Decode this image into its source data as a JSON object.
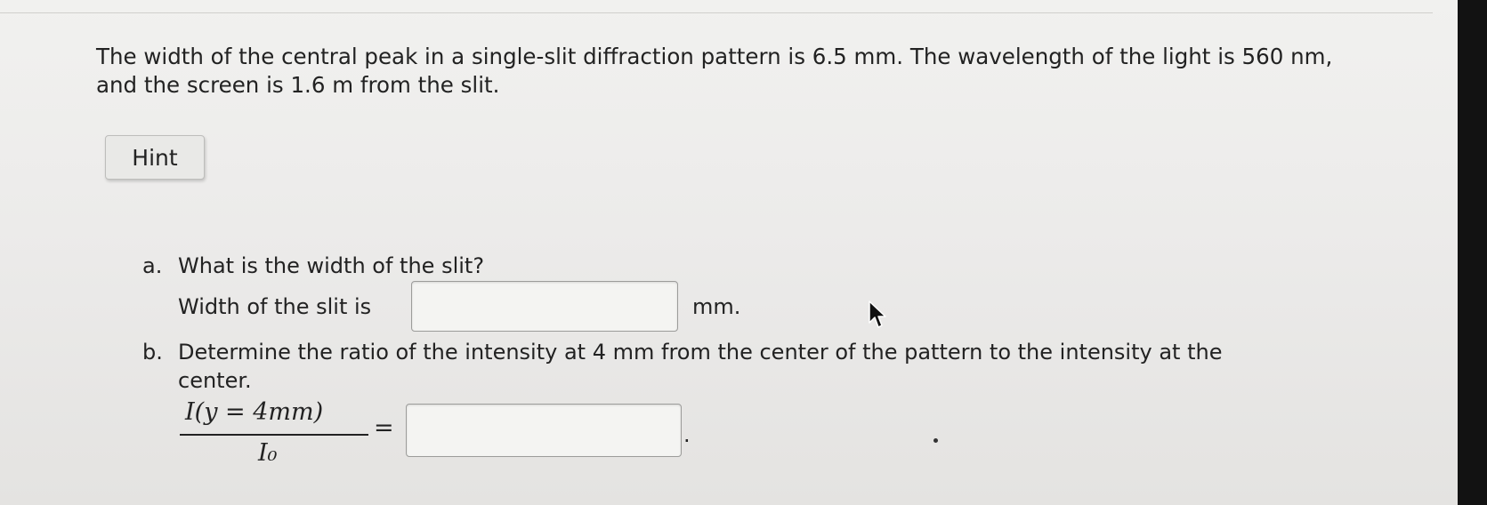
{
  "problem": {
    "text": "The width of the central peak in a single-slit diffraction pattern is 6.5 mm. The wavelength of the light is 560 nm, and the screen is 1.6 m from the slit."
  },
  "hint": {
    "label": "Hint"
  },
  "part_a": {
    "marker": "a.",
    "question": "What is the width of the slit?",
    "prefix": "Width of the slit is",
    "value": "",
    "unit": "mm."
  },
  "part_b": {
    "marker": "b.",
    "question_line1": "Determine the ratio of the intensity at 4 mm from the center of the pattern to the intensity at the",
    "question_line2": "center.",
    "numerator": "I(y = 4mm)",
    "denominator": "I₀",
    "equals": "=",
    "value": "",
    "trailing": "."
  },
  "icons": {
    "cursor": "mouse-pointer-icon"
  }
}
